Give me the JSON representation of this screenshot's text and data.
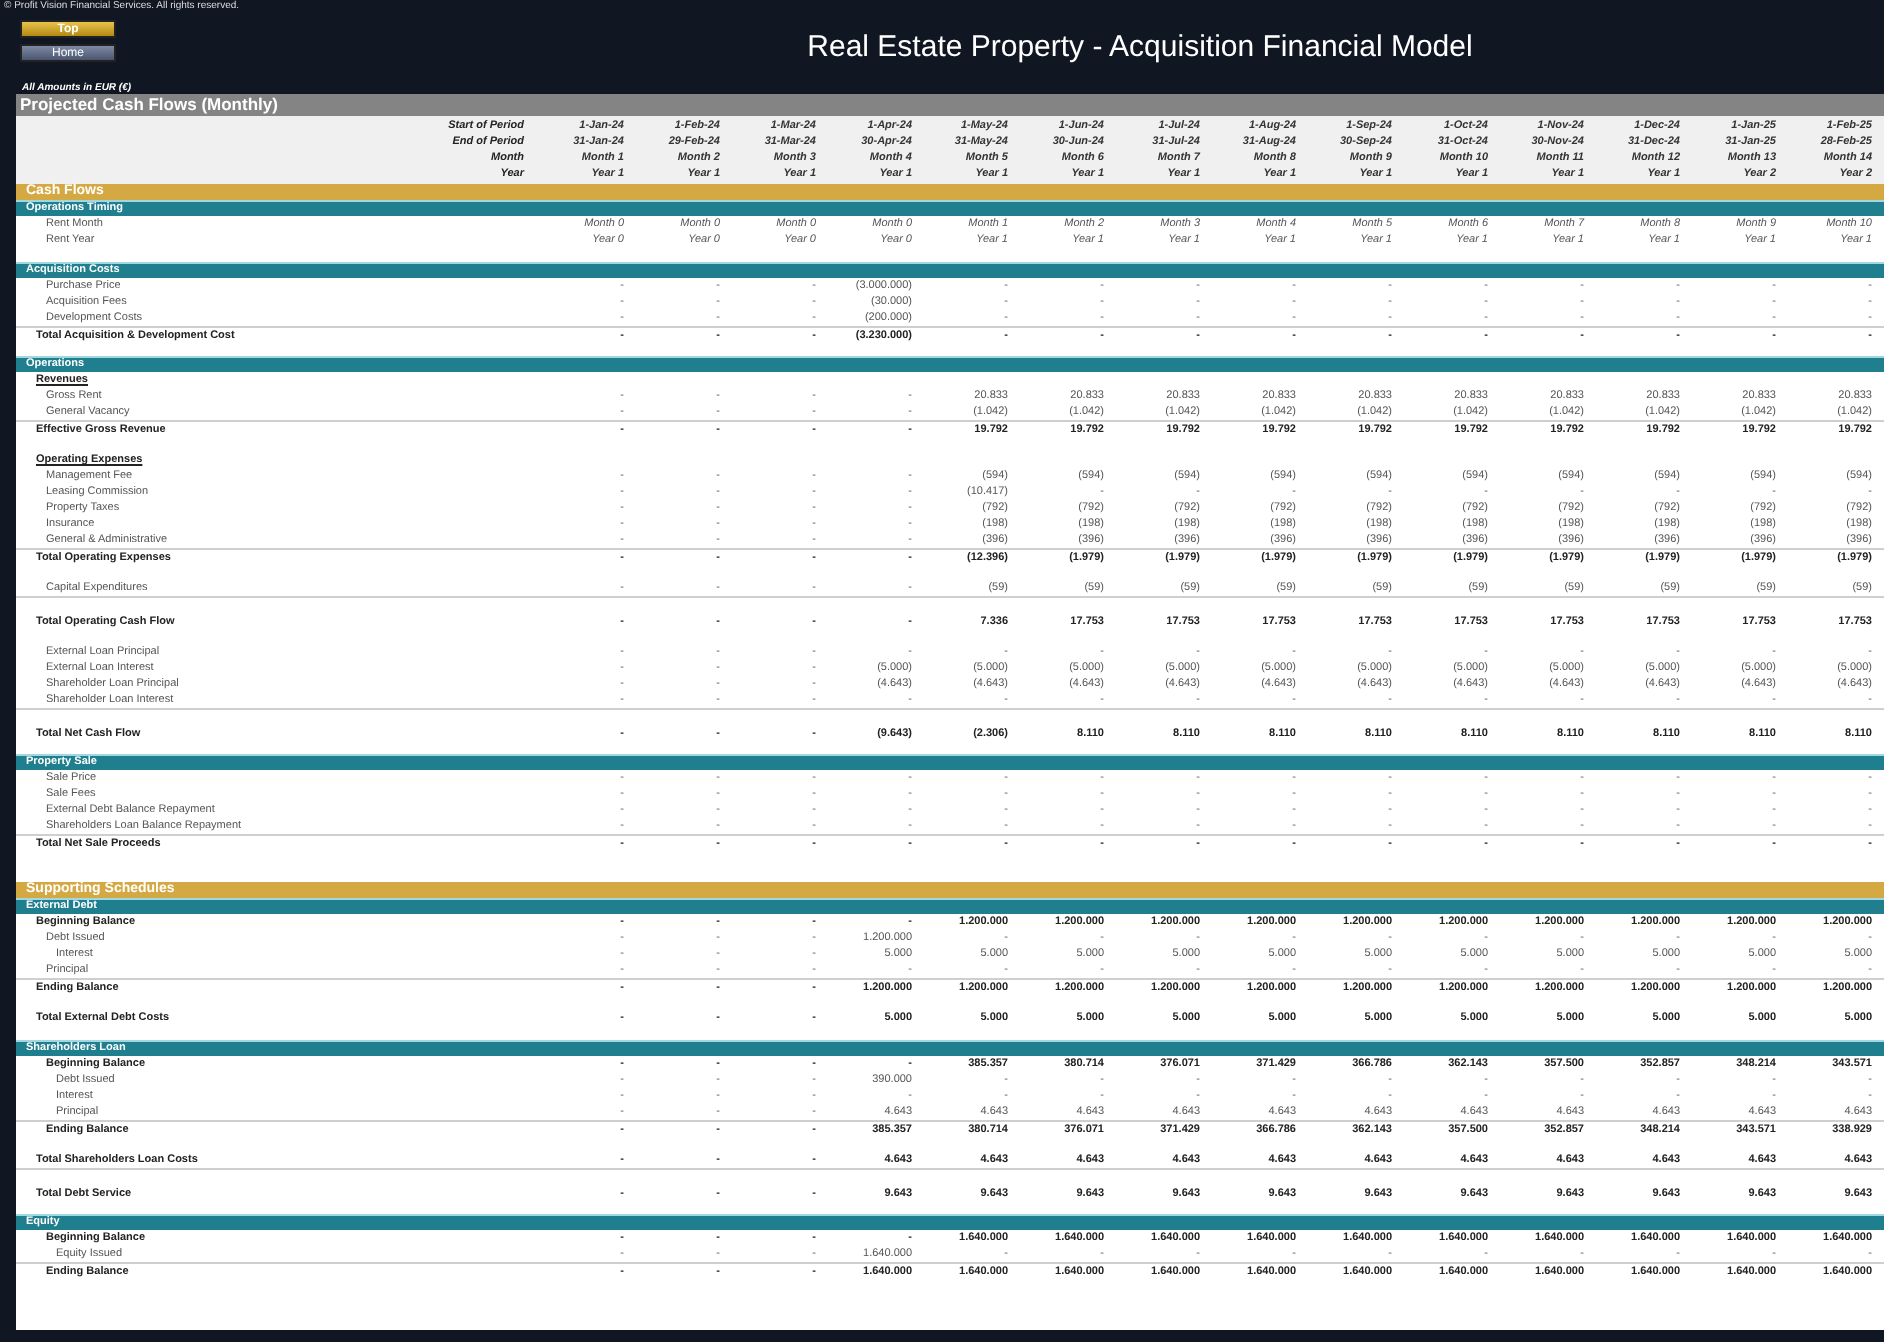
{
  "copyright": "© Profit Vision Financial Services. All rights reserved.",
  "nav_buttons": [
    {
      "label": "Top",
      "kind": "gold"
    },
    {
      "label": "Home",
      "kind": "slate"
    }
  ],
  "title": "Real Estate Property - Acquisition Financial Model",
  "currency_note": "All Amounts in  EUR (€)",
  "sheet_title": "Projected Cash Flows (Monthly)",
  "period_header": [
    {
      "label": "Start of Period",
      "values": [
        "1-Jan-24",
        "1-Feb-24",
        "1-Mar-24",
        "1-Apr-24",
        "1-May-24",
        "1-Jun-24",
        "1-Jul-24",
        "1-Aug-24",
        "1-Sep-24",
        "1-Oct-24",
        "1-Nov-24",
        "1-Dec-24",
        "1-Jan-25",
        "1-Feb-25"
      ]
    },
    {
      "label": "End of Period",
      "values": [
        "31-Jan-24",
        "29-Feb-24",
        "31-Mar-24",
        "30-Apr-24",
        "31-May-24",
        "30-Jun-24",
        "31-Jul-24",
        "31-Aug-24",
        "30-Sep-24",
        "31-Oct-24",
        "30-Nov-24",
        "31-Dec-24",
        "31-Jan-25",
        "28-Feb-25"
      ]
    },
    {
      "label": "Month",
      "values": [
        "Month 1",
        "Month 2",
        "Month 3",
        "Month 4",
        "Month 5",
        "Month 6",
        "Month 7",
        "Month 8",
        "Month 9",
        "Month 10",
        "Month 11",
        "Month 12",
        "Month 13",
        "Month 14"
      ]
    },
    {
      "label": "Year",
      "values": [
        "Year 1",
        "Year 1",
        "Year 1",
        "Year 1",
        "Year 1",
        "Year 1",
        "Year 1",
        "Year 1",
        "Year 1",
        "Year 1",
        "Year 1",
        "Year 1",
        "Year 2",
        "Year 2"
      ]
    }
  ],
  "groups": [
    {
      "title": "Cash Flows",
      "sections": [
        {
          "title": "Operations Timing",
          "rows": [
            {
              "label": "Rent Month",
              "kind": "timing",
              "values": [
                "Month 0",
                "Month 0",
                "Month 0",
                "Month 0",
                "Month 1",
                "Month 2",
                "Month 3",
                "Month 4",
                "Month 5",
                "Month 6",
                "Month 7",
                "Month 8",
                "Month 9",
                "Month 10"
              ]
            },
            {
              "label": "Rent Year",
              "kind": "timing",
              "values": [
                "Year 0",
                "Year 0",
                "Year 0",
                "Year 0",
                "Year 1",
                "Year 1",
                "Year 1",
                "Year 1",
                "Year 1",
                "Year 1",
                "Year 1",
                "Year 1",
                "Year 1",
                "Year 1"
              ]
            }
          ]
        },
        {
          "title": "Acquisition Costs",
          "rows": [
            {
              "label": "Purchase Price",
              "kind": "item",
              "values": [
                "-",
                "-",
                "-",
                "(3.000.000)",
                "-",
                "-",
                "-",
                "-",
                "-",
                "-",
                "-",
                "-",
                "-",
                "-"
              ]
            },
            {
              "label": "Acquisition Fees",
              "kind": "item",
              "values": [
                "-",
                "-",
                "-",
                "(30.000)",
                "-",
                "-",
                "-",
                "-",
                "-",
                "-",
                "-",
                "-",
                "-",
                "-"
              ]
            },
            {
              "label": "Development Costs",
              "kind": "item",
              "values": [
                "-",
                "-",
                "-",
                "(200.000)",
                "-",
                "-",
                "-",
                "-",
                "-",
                "-",
                "-",
                "-",
                "-",
                "-"
              ]
            },
            {
              "label": "Total Acquisition & Development Cost",
              "kind": "total",
              "values": [
                "-",
                "-",
                "-",
                "(3.230.000)",
                "-",
                "-",
                "-",
                "-",
                "-",
                "-",
                "-",
                "-",
                "-",
                "-"
              ]
            }
          ]
        },
        {
          "title": "Operations",
          "rows": [
            {
              "label": "Revenues",
              "kind": "heading"
            },
            {
              "label": "Gross Rent",
              "kind": "item",
              "values": [
                "-",
                "-",
                "-",
                "-",
                "20.833",
                "20.833",
                "20.833",
                "20.833",
                "20.833",
                "20.833",
                "20.833",
                "20.833",
                "20.833",
                "20.833"
              ]
            },
            {
              "label": "General Vacancy",
              "kind": "item",
              "values": [
                "-",
                "-",
                "-",
                "-",
                "(1.042)",
                "(1.042)",
                "(1.042)",
                "(1.042)",
                "(1.042)",
                "(1.042)",
                "(1.042)",
                "(1.042)",
                "(1.042)",
                "(1.042)"
              ]
            },
            {
              "label": "Effective Gross Revenue",
              "kind": "total",
              "values": [
                "-",
                "-",
                "-",
                "-",
                "19.792",
                "19.792",
                "19.792",
                "19.792",
                "19.792",
                "19.792",
                "19.792",
                "19.792",
                "19.792",
                "19.792"
              ]
            },
            {
              "label": "Operating Expenses",
              "kind": "heading",
              "space_before": true
            },
            {
              "label": "Management Fee",
              "kind": "item",
              "values": [
                "-",
                "-",
                "-",
                "-",
                "(594)",
                "(594)",
                "(594)",
                "(594)",
                "(594)",
                "(594)",
                "(594)",
                "(594)",
                "(594)",
                "(594)"
              ]
            },
            {
              "label": "Leasing Commission",
              "kind": "item",
              "values": [
                "-",
                "-",
                "-",
                "-",
                "(10.417)",
                "-",
                "-",
                "-",
                "-",
                "-",
                "-",
                "-",
                "-",
                "-"
              ]
            },
            {
              "label": "Property Taxes",
              "kind": "item",
              "values": [
                "-",
                "-",
                "-",
                "-",
                "(792)",
                "(792)",
                "(792)",
                "(792)",
                "(792)",
                "(792)",
                "(792)",
                "(792)",
                "(792)",
                "(792)"
              ]
            },
            {
              "label": "Insurance",
              "kind": "item",
              "values": [
                "-",
                "-",
                "-",
                "-",
                "(198)",
                "(198)",
                "(198)",
                "(198)",
                "(198)",
                "(198)",
                "(198)",
                "(198)",
                "(198)",
                "(198)"
              ]
            },
            {
              "label": "General & Administrative",
              "kind": "item",
              "values": [
                "-",
                "-",
                "-",
                "-",
                "(396)",
                "(396)",
                "(396)",
                "(396)",
                "(396)",
                "(396)",
                "(396)",
                "(396)",
                "(396)",
                "(396)"
              ]
            },
            {
              "label": "Total Operating Expenses",
              "kind": "total",
              "values": [
                "-",
                "-",
                "-",
                "-",
                "(12.396)",
                "(1.979)",
                "(1.979)",
                "(1.979)",
                "(1.979)",
                "(1.979)",
                "(1.979)",
                "(1.979)",
                "(1.979)",
                "(1.979)"
              ]
            },
            {
              "label": "Capital Expenditures",
              "kind": "item",
              "space_before": true,
              "values": [
                "-",
                "-",
                "-",
                "-",
                "(59)",
                "(59)",
                "(59)",
                "(59)",
                "(59)",
                "(59)",
                "(59)",
                "(59)",
                "(59)",
                "(59)"
              ]
            },
            {
              "label": "Total Operating Cash Flow",
              "kind": "total",
              "space_before": true,
              "values": [
                "-",
                "-",
                "-",
                "-",
                "7.336",
                "17.753",
                "17.753",
                "17.753",
                "17.753",
                "17.753",
                "17.753",
                "17.753",
                "17.753",
                "17.753"
              ]
            },
            {
              "label": "External Loan Principal",
              "kind": "item",
              "space_before": true,
              "values": [
                "-",
                "-",
                "-",
                "-",
                "-",
                "-",
                "-",
                "-",
                "-",
                "-",
                "-",
                "-",
                "-",
                "-"
              ]
            },
            {
              "label": "External Loan Interest",
              "kind": "item",
              "values": [
                "-",
                "-",
                "-",
                "(5.000)",
                "(5.000)",
                "(5.000)",
                "(5.000)",
                "(5.000)",
                "(5.000)",
                "(5.000)",
                "(5.000)",
                "(5.000)",
                "(5.000)",
                "(5.000)"
              ]
            },
            {
              "label": "Shareholder Loan Principal",
              "kind": "item",
              "values": [
                "-",
                "-",
                "-",
                "(4.643)",
                "(4.643)",
                "(4.643)",
                "(4.643)",
                "(4.643)",
                "(4.643)",
                "(4.643)",
                "(4.643)",
                "(4.643)",
                "(4.643)",
                "(4.643)"
              ]
            },
            {
              "label": "Shareholder Loan Interest",
              "kind": "item",
              "values": [
                "-",
                "-",
                "-",
                "-",
                "-",
                "-",
                "-",
                "-",
                "-",
                "-",
                "-",
                "-",
                "-",
                "-"
              ]
            },
            {
              "label": "Total Net Cash Flow",
              "kind": "total",
              "space_before": true,
              "values": [
                "-",
                "-",
                "-",
                "(9.643)",
                "(2.306)",
                "8.110",
                "8.110",
                "8.110",
                "8.110",
                "8.110",
                "8.110",
                "8.110",
                "8.110",
                "8.110"
              ]
            }
          ]
        },
        {
          "title": "Property Sale",
          "rows": [
            {
              "label": "Sale Price",
              "kind": "item",
              "values": [
                "-",
                "-",
                "-",
                "-",
                "-",
                "-",
                "-",
                "-",
                "-",
                "-",
                "-",
                "-",
                "-",
                "-"
              ]
            },
            {
              "label": "Sale Fees",
              "kind": "item",
              "values": [
                "-",
                "-",
                "-",
                "-",
                "-",
                "-",
                "-",
                "-",
                "-",
                "-",
                "-",
                "-",
                "-",
                "-"
              ]
            },
            {
              "label": "External Debt Balance Repayment",
              "kind": "item",
              "values": [
                "-",
                "-",
                "-",
                "-",
                "-",
                "-",
                "-",
                "-",
                "-",
                "-",
                "-",
                "-",
                "-",
                "-"
              ]
            },
            {
              "label": "Shareholders Loan Balance Repayment",
              "kind": "item",
              "values": [
                "-",
                "-",
                "-",
                "-",
                "-",
                "-",
                "-",
                "-",
                "-",
                "-",
                "-",
                "-",
                "-",
                "-"
              ]
            },
            {
              "label": "Total Net Sale Proceeds",
              "kind": "total",
              "values": [
                "-",
                "-",
                "-",
                "-",
                "-",
                "-",
                "-",
                "-",
                "-",
                "-",
                "-",
                "-",
                "-",
                "-"
              ]
            }
          ]
        }
      ]
    },
    {
      "title": "Supporting Schedules",
      "sections": [
        {
          "title": "External Debt",
          "rows": [
            {
              "label": "Beginning Balance",
              "kind": "total_plain",
              "values": [
                "-",
                "-",
                "-",
                "-",
                "1.200.000",
                "1.200.000",
                "1.200.000",
                "1.200.000",
                "1.200.000",
                "1.200.000",
                "1.200.000",
                "1.200.000",
                "1.200.000",
                "1.200.000"
              ]
            },
            {
              "label": "Debt Issued",
              "kind": "item",
              "values": [
                "-",
                "-",
                "-",
                "1.200.000",
                "-",
                "-",
                "-",
                "-",
                "-",
                "-",
                "-",
                "-",
                "-",
                "-"
              ]
            },
            {
              "label": "Interest",
              "kind": "sub_item",
              "values": [
                "-",
                "-",
                "-",
                "5.000",
                "5.000",
                "5.000",
                "5.000",
                "5.000",
                "5.000",
                "5.000",
                "5.000",
                "5.000",
                "5.000",
                "5.000"
              ]
            },
            {
              "label": "Principal",
              "kind": "item",
              "values": [
                "-",
                "-",
                "-",
                "-",
                "-",
                "-",
                "-",
                "-",
                "-",
                "-",
                "-",
                "-",
                "-",
                "-"
              ]
            },
            {
              "label": "Ending Balance",
              "kind": "total",
              "values": [
                "-",
                "-",
                "-",
                "1.200.000",
                "1.200.000",
                "1.200.000",
                "1.200.000",
                "1.200.000",
                "1.200.000",
                "1.200.000",
                "1.200.000",
                "1.200.000",
                "1.200.000",
                "1.200.000"
              ]
            },
            {
              "label": "Total External Debt Costs",
              "kind": "total_plain",
              "space_before": true,
              "values": [
                "-",
                "-",
                "-",
                "5.000",
                "5.000",
                "5.000",
                "5.000",
                "5.000",
                "5.000",
                "5.000",
                "5.000",
                "5.000",
                "5.000",
                "5.000"
              ]
            }
          ]
        },
        {
          "title": "Shareholders Loan",
          "rows": [
            {
              "label": "Beginning Balance",
              "kind": "sub_total",
              "values": [
                "-",
                "-",
                "-",
                "-",
                "385.357",
                "380.714",
                "376.071",
                "371.429",
                "366.786",
                "362.143",
                "357.500",
                "352.857",
                "348.214",
                "343.571"
              ]
            },
            {
              "label": "Debt Issued",
              "kind": "sub_item",
              "values": [
                "-",
                "-",
                "-",
                "390.000",
                "-",
                "-",
                "-",
                "-",
                "-",
                "-",
                "-",
                "-",
                "-",
                "-"
              ]
            },
            {
              "label": "Interest",
              "kind": "sub_item",
              "values": [
                "-",
                "-",
                "-",
                "-",
                "-",
                "-",
                "-",
                "-",
                "-",
                "-",
                "-",
                "-",
                "-",
                "-"
              ]
            },
            {
              "label": "Principal",
              "kind": "sub_item",
              "values": [
                "-",
                "-",
                "-",
                "4.643",
                "4.643",
                "4.643",
                "4.643",
                "4.643",
                "4.643",
                "4.643",
                "4.643",
                "4.643",
                "4.643",
                "4.643"
              ]
            },
            {
              "label": "Ending Balance",
              "kind": "sub_total_line",
              "values": [
                "-",
                "-",
                "-",
                "385.357",
                "380.714",
                "376.071",
                "371.429",
                "366.786",
                "362.143",
                "357.500",
                "352.857",
                "348.214",
                "343.571",
                "338.929"
              ]
            },
            {
              "label": "Total Shareholders Loan Costs",
              "kind": "total_plain",
              "space_before": true,
              "values": [
                "-",
                "-",
                "-",
                "4.643",
                "4.643",
                "4.643",
                "4.643",
                "4.643",
                "4.643",
                "4.643",
                "4.643",
                "4.643",
                "4.643",
                "4.643"
              ]
            },
            {
              "label": "Total Debt Service",
              "kind": "total",
              "space_before": true,
              "values": [
                "-",
                "-",
                "-",
                "9.643",
                "9.643",
                "9.643",
                "9.643",
                "9.643",
                "9.643",
                "9.643",
                "9.643",
                "9.643",
                "9.643",
                "9.643"
              ]
            }
          ]
        },
        {
          "title": "Equity",
          "rows": [
            {
              "label": "Beginning Balance",
              "kind": "sub_total",
              "values": [
                "-",
                "-",
                "-",
                "-",
                "1.640.000",
                "1.640.000",
                "1.640.000",
                "1.640.000",
                "1.640.000",
                "1.640.000",
                "1.640.000",
                "1.640.000",
                "1.640.000",
                "1.640.000"
              ]
            },
            {
              "label": "Equity Issued",
              "kind": "sub_item",
              "values": [
                "-",
                "-",
                "-",
                "1.640.000",
                "-",
                "-",
                "-",
                "-",
                "-",
                "-",
                "-",
                "-",
                "-",
                "-"
              ]
            },
            {
              "label": "Ending Balance",
              "kind": "sub_total_line",
              "values": [
                "-",
                "-",
                "-",
                "1.640.000",
                "1.640.000",
                "1.640.000",
                "1.640.000",
                "1.640.000",
                "1.640.000",
                "1.640.000",
                "1.640.000",
                "1.640.000",
                "1.640.000",
                "1.640.000"
              ]
            }
          ]
        }
      ]
    }
  ]
}
